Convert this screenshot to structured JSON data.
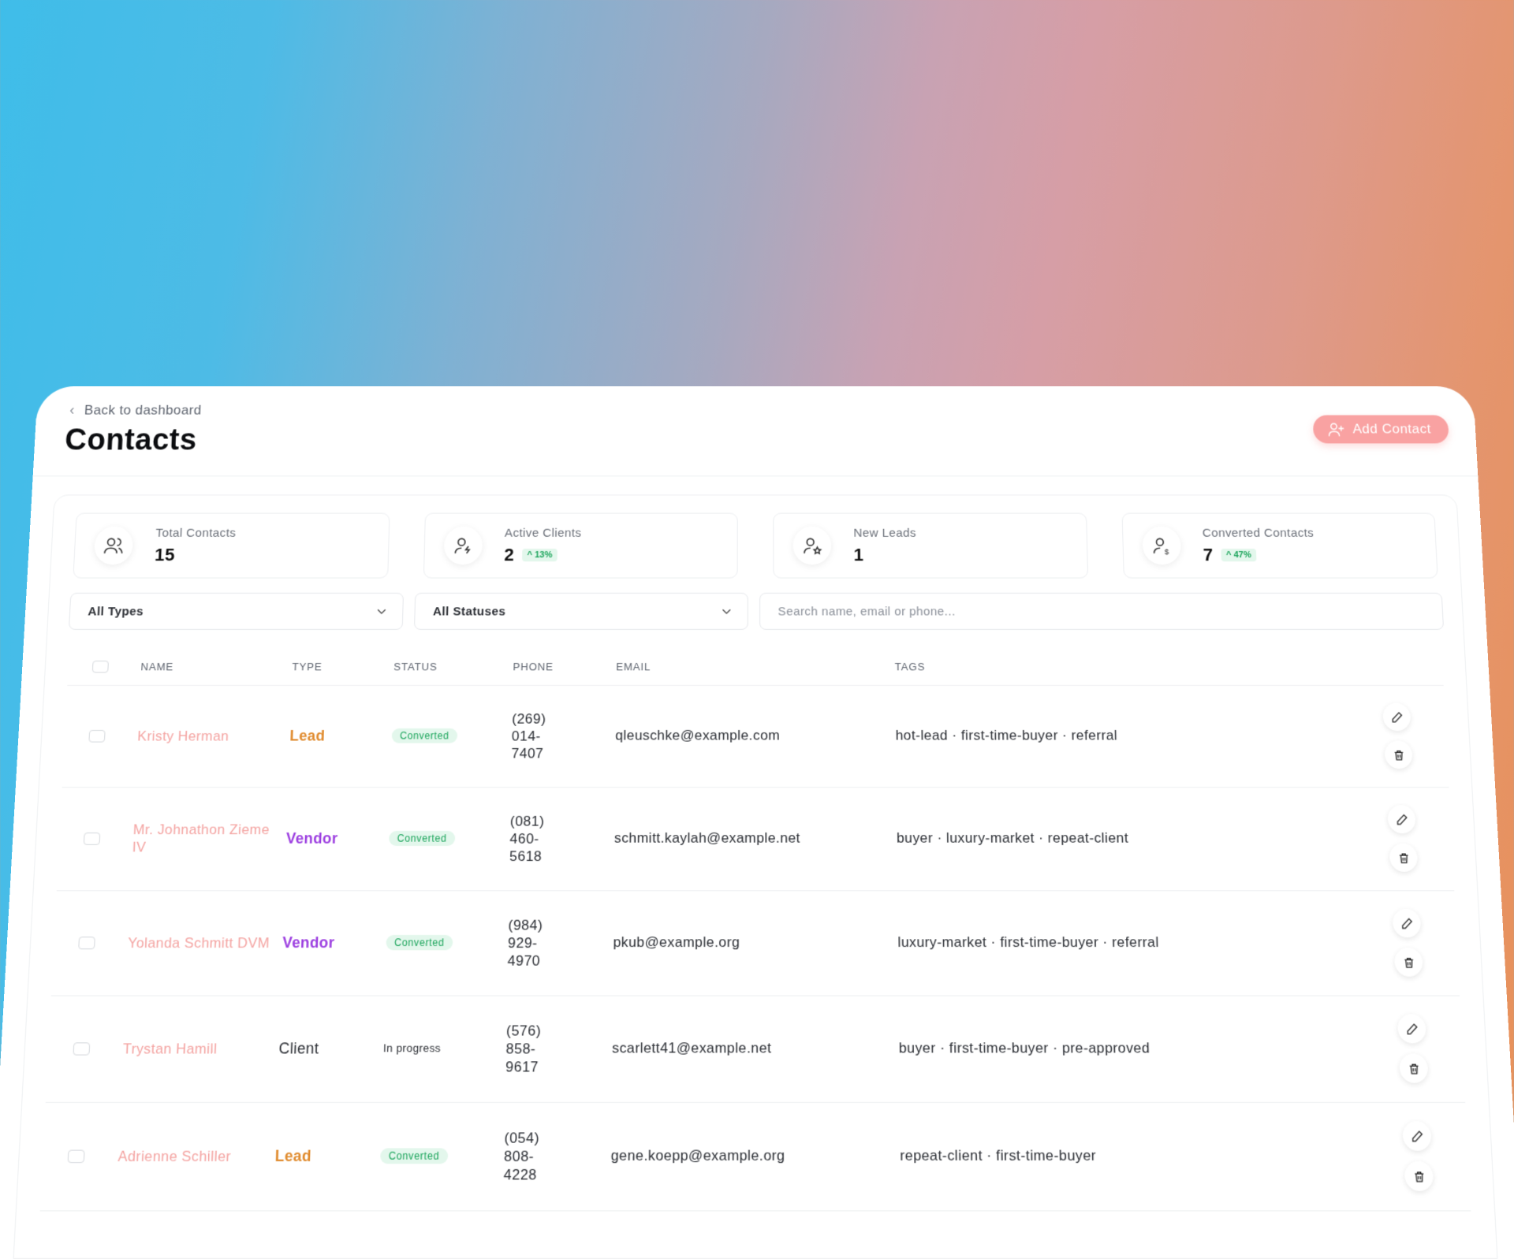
{
  "header": {
    "back_label": "Back to dashboard",
    "title": "Contacts",
    "add_button_label": "Add Contact"
  },
  "stats": [
    {
      "label": "Total Contacts",
      "value": "15",
      "change": "",
      "icon": "users-icon"
    },
    {
      "label": "Active Clients",
      "value": "2",
      "change": "13%",
      "icon": "user-bolt-icon"
    },
    {
      "label": "New Leads",
      "value": "1",
      "change": "",
      "icon": "user-star-icon"
    },
    {
      "label": "Converted Contacts",
      "value": "7",
      "change": "47%",
      "icon": "user-dollar-icon"
    }
  ],
  "filters": {
    "type_selected": "All Types",
    "status_selected": "All Statuses",
    "search_placeholder": "Search name, email or phone..."
  },
  "table": {
    "columns": [
      "NAME",
      "TYPE",
      "STATUS",
      "PHONE",
      "EMAIL",
      "TAGS"
    ],
    "rows": [
      {
        "name": "Kristy Herman",
        "type": "Lead",
        "status": "Converted",
        "phone": "(269) 014-7407",
        "email": "qleuschke@example.com",
        "tags": "hot-lead · first-time-buyer · referral"
      },
      {
        "name": "Mr. Johnathon Zieme IV",
        "type": "Vendor",
        "status": "Converted",
        "phone": "(081) 460-5618",
        "email": "schmitt.kaylah@example.net",
        "tags": "buyer · luxury-market · repeat-client"
      },
      {
        "name": "Yolanda Schmitt DVM",
        "type": "Vendor",
        "status": "Converted",
        "phone": "(984) 929-4970",
        "email": "pkub@example.org",
        "tags": "luxury-market · first-time-buyer · referral"
      },
      {
        "name": "Trystan Hamill",
        "type": "Client",
        "status": "In progress",
        "phone": "(576) 858-9617",
        "email": "scarlett41@example.net",
        "tags": "buyer · first-time-buyer · pre-approved"
      },
      {
        "name": "Adrienne Schiller",
        "type": "Lead",
        "status": "Converted",
        "phone": "(054) 808-4228",
        "email": "gene.koepp@example.org",
        "tags": "repeat-client · first-time-buyer"
      }
    ]
  },
  "colors": {
    "accent": "#f9a2a2",
    "lead": "#e08a2c",
    "vendor": "#9b3de0",
    "converted": "#1aa45a"
  }
}
